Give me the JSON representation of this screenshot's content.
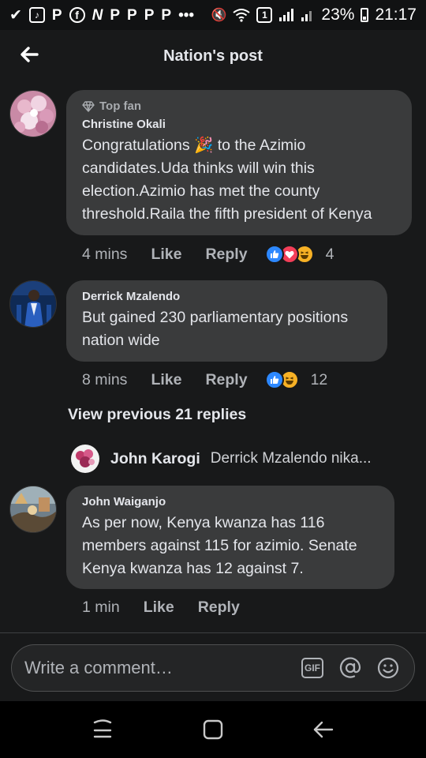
{
  "status_bar": {
    "battery": "23%",
    "time": "21:17",
    "left_icons": [
      "checkmark-icon",
      "tiktok-icon",
      "pinterest-icon",
      "facebook-icon",
      "news-icon",
      "pinterest-icon",
      "pinterest-icon",
      "pinterest-icon",
      "pinterest-icon"
    ],
    "more": "•••",
    "sim_badge": "1"
  },
  "header": {
    "title": "Nation's post"
  },
  "comments": [
    {
      "badge": "Top fan",
      "author": "Christine Okali",
      "text": "Congratulations 🎉 to the Azimio candidates.Uda thinks will win this election.Azimio has met the county threshold.Raila the fifth president of Kenya",
      "time": "4 mins",
      "like_label": "Like",
      "reply_label": "Reply",
      "reactions": [
        "like",
        "love",
        "haha"
      ],
      "reaction_count": "4"
    },
    {
      "author": "Derrick Mzalendo",
      "text": "But gained 230 parliamentary positions nation wide",
      "time": "8 mins",
      "like_label": "Like",
      "reply_label": "Reply",
      "reactions": [
        "like",
        "haha"
      ],
      "reaction_count": "12"
    },
    {
      "author": "John Waiganjo",
      "text": "As per now, Kenya kwanza has 116 members against 115 for azimio. Senate Kenya kwanza has 12 against 7.",
      "time": "1 min",
      "like_label": "Like",
      "reply_label": "Reply"
    }
  ],
  "view_previous": "View previous 21 replies",
  "latest_reply": {
    "author": "John Karogi",
    "snippet": "Derrick Mzalendo nika..."
  },
  "composer": {
    "placeholder": "Write a comment…",
    "gif_label": "GIF"
  },
  "colors": {
    "background": "#18191a",
    "bubble": "#3a3b3c",
    "like_blue": "#2d88ff",
    "love_red": "#f33e58",
    "haha_yellow": "#f7b125"
  }
}
